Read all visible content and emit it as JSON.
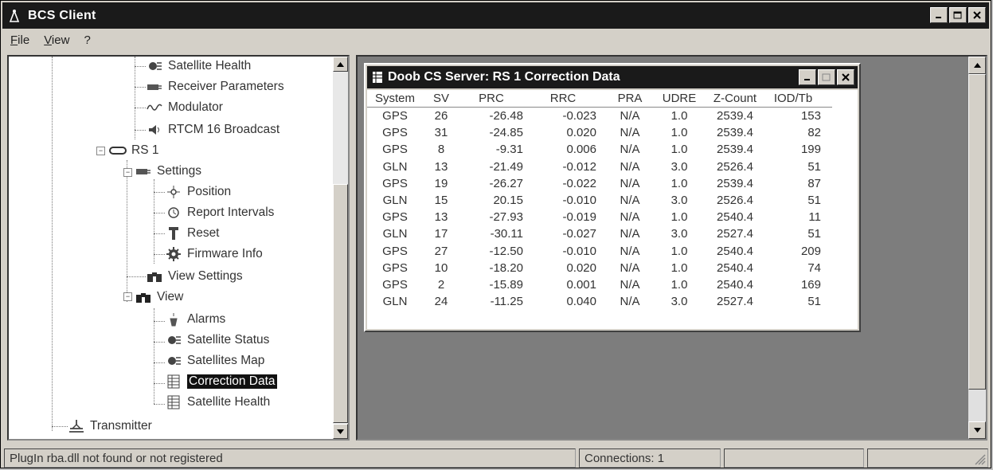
{
  "window": {
    "title": "BCS Client"
  },
  "menu": [
    "File",
    "View",
    "?"
  ],
  "tree": {
    "items": [
      {
        "label": "Satellite Health",
        "icon": "satellite-icon"
      },
      {
        "label": "Receiver Parameters",
        "icon": "receiver-icon"
      },
      {
        "label": "Modulator",
        "icon": "waveform-icon"
      },
      {
        "label": "RTCM 16 Broadcast",
        "icon": "speaker-icon"
      },
      {
        "label": "RS 1",
        "icon": "station-icon"
      },
      {
        "label": "Settings",
        "icon": "receiver-icon"
      },
      {
        "label": "Position",
        "icon": "position-icon"
      },
      {
        "label": "Report Intervals",
        "icon": "clock-icon"
      },
      {
        "label": "Reset",
        "icon": "reset-icon"
      },
      {
        "label": "Firmware Info",
        "icon": "gear-icon"
      },
      {
        "label": "View Settings",
        "icon": "binoculars-icon"
      },
      {
        "label": "View",
        "icon": "binoculars-icon"
      },
      {
        "label": "Alarms",
        "icon": "alarm-icon"
      },
      {
        "label": "Satellite Status",
        "icon": "satellite-icon"
      },
      {
        "label": "Satellites Map",
        "icon": "satellite-icon"
      },
      {
        "label": "Correction Data",
        "icon": "table-icon"
      },
      {
        "label": "Satellite Health",
        "icon": "table-icon"
      },
      {
        "label": "Transmitter",
        "icon": "transmitter-icon"
      }
    ]
  },
  "child": {
    "title": "Doob CS Server: RS 1 Correction Data",
    "columns": [
      "System",
      "SV",
      "PRC",
      "RRC",
      "PRA",
      "UDRE",
      "Z-Count",
      "IOD/Tb"
    ],
    "rows": [
      [
        "GPS",
        "26",
        "-26.48",
        "-0.023",
        "N/A",
        "1.0",
        "2539.4",
        "153"
      ],
      [
        "GPS",
        "31",
        "-24.85",
        "0.020",
        "N/A",
        "1.0",
        "2539.4",
        "82"
      ],
      [
        "GPS",
        "8",
        "-9.31",
        "0.006",
        "N/A",
        "1.0",
        "2539.4",
        "199"
      ],
      [
        "GLN",
        "13",
        "-21.49",
        "-0.012",
        "N/A",
        "3.0",
        "2526.4",
        "51"
      ],
      [
        "GPS",
        "19",
        "-26.27",
        "-0.022",
        "N/A",
        "1.0",
        "2539.4",
        "87"
      ],
      [
        "GLN",
        "15",
        "20.15",
        "-0.010",
        "N/A",
        "3.0",
        "2526.4",
        "51"
      ],
      [
        "GPS",
        "13",
        "-27.93",
        "-0.019",
        "N/A",
        "1.0",
        "2540.4",
        "11"
      ],
      [
        "GLN",
        "17",
        "-30.11",
        "-0.027",
        "N/A",
        "3.0",
        "2527.4",
        "51"
      ],
      [
        "GPS",
        "27",
        "-12.50",
        "-0.010",
        "N/A",
        "1.0",
        "2540.4",
        "209"
      ],
      [
        "GPS",
        "10",
        "-18.20",
        "0.020",
        "N/A",
        "1.0",
        "2540.4",
        "74"
      ],
      [
        "GPS",
        "2",
        "-15.89",
        "0.001",
        "N/A",
        "1.0",
        "2540.4",
        "169"
      ],
      [
        "GLN",
        "24",
        "-11.25",
        "0.040",
        "N/A",
        "3.0",
        "2527.4",
        "51"
      ]
    ]
  },
  "status": {
    "message": "PlugIn rba.dll not found or not registered",
    "connections": "Connections: 1"
  }
}
